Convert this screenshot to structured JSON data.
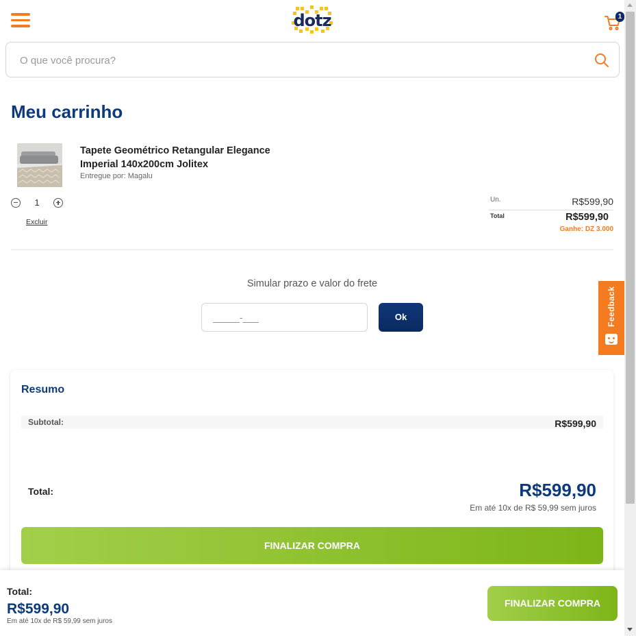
{
  "header": {
    "logo_text": "dotz",
    "cart_count": "1"
  },
  "search": {
    "placeholder": "O que você procura?",
    "value": ""
  },
  "page_title": "Meu carrinho",
  "cart": {
    "item": {
      "name": "Tapete Geométrico Retangular Elegance Imperial 140x200cm Jolitex",
      "seller": "Entregue por: Magalu",
      "quantity": "1",
      "remove_label": "Excluir",
      "unit_label": "Un.",
      "unit_price": "R$599,90",
      "total_label": "Total",
      "total_price": "R$599,90",
      "earn": "Ganhe: DZ 3.000"
    }
  },
  "shipping": {
    "title": "Simular prazo e valor do frete",
    "cep_placeholder": "_____-___",
    "ok_label": "Ok"
  },
  "feedback": {
    "label": "Feedback"
  },
  "summary": {
    "title": "Resumo",
    "subtotal_label": "Subtotal:",
    "subtotal_value": "R$599,90",
    "total_label": "Total:",
    "total_value": "R$599,90",
    "installments": "Em até 10x de R$ 59,99 sem juros",
    "finalize_label": "FINALIZAR COMPRA"
  },
  "bottom_bar": {
    "total_label": "Total:",
    "total_value": "R$599,90",
    "installments": "Em até 10x de R$ 59,99 sem juros",
    "finalize_label": "FINALIZAR COMPRA"
  },
  "colors": {
    "brand_orange": "#f47b20",
    "brand_navy": "#0d3a7a",
    "cta_green": "#8cc12a"
  }
}
